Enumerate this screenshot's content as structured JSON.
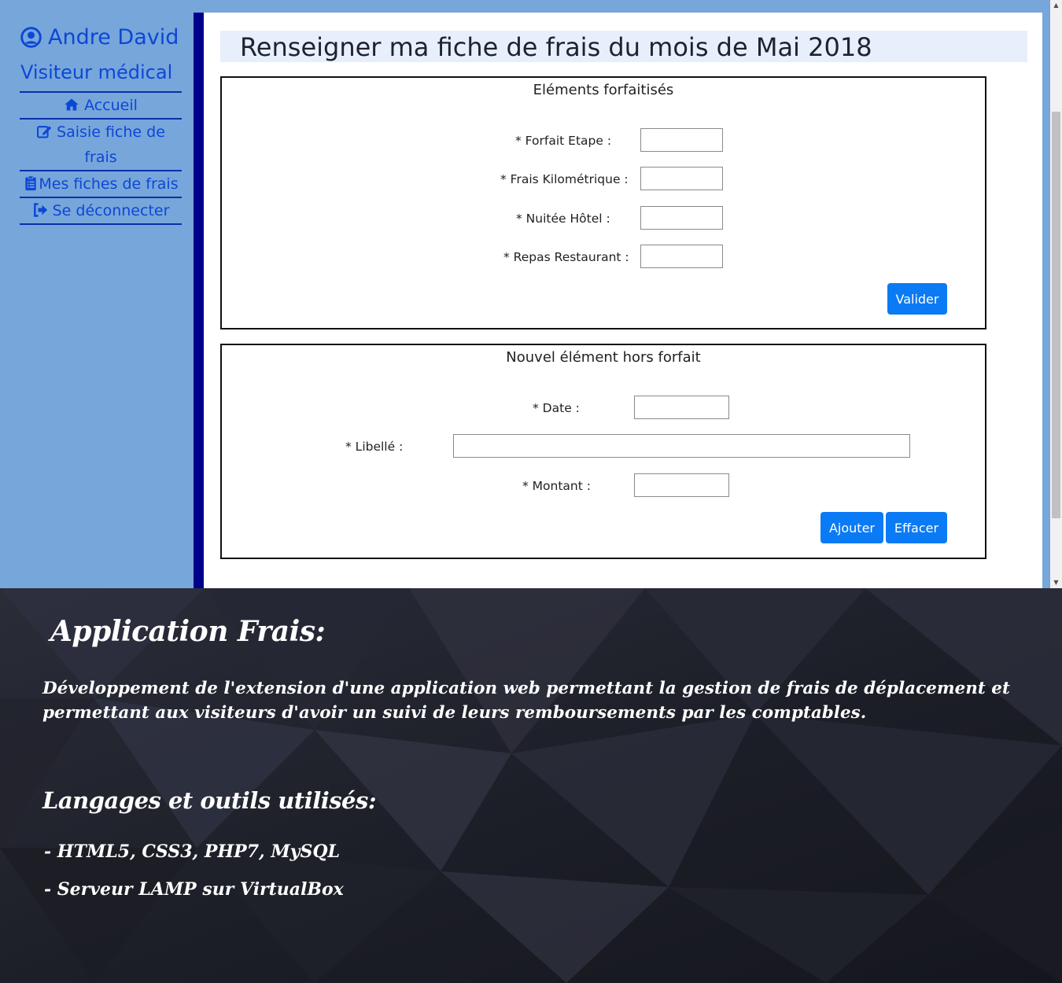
{
  "sidebar": {
    "user_name": "Andre David",
    "user_role": "Visiteur médical",
    "nav": {
      "home": "Accueil",
      "entry_line1": "Saisie fiche de",
      "entry_line2": "frais",
      "sheets": "Mes fiches de frais",
      "logout": "Se déconnecter"
    }
  },
  "main": {
    "title": "Renseigner ma fiche de frais du mois de Mai 2018",
    "forfait": {
      "legend": "Eléments forfaitisés",
      "etape_label": "* Forfait Etape :",
      "km_label": "* Frais Kilométrique :",
      "hotel_label": "* Nuitée Hôtel :",
      "repas_label": "* Repas Restaurant :",
      "validate": "Valider"
    },
    "hors_forfait": {
      "legend": "Nouvel élément hors forfait",
      "date_label": "* Date :",
      "libelle_label": "* Libellé :",
      "montant_label": "* Montant :",
      "add": "Ajouter",
      "clear": "Effacer"
    }
  },
  "promo": {
    "title": "Application Frais:",
    "description": "Développement de l'extension d'une application web permettant la gestion de frais de déplacement et permettant aux visiteurs d'avoir un suivi de leurs remboursements par les comptables.",
    "tools_title": "Langages et outils utilisés:",
    "tool_1": "- HTML5, CSS3, PHP7, MySQL",
    "tool_2": "- Serveur LAMP sur VirtualBox"
  },
  "colors": {
    "sidebar_bg": "#77a6db",
    "link": "#0d47d6",
    "divider": "#00008b",
    "button": "#0b7af5",
    "title_bg": "#e7effc",
    "promo_bg": "#1e2029"
  }
}
